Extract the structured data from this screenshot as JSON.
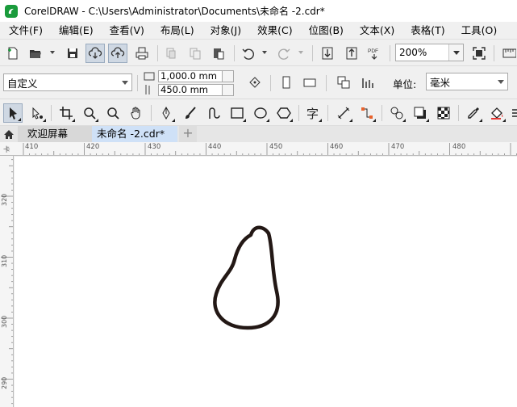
{
  "window": {
    "title": "CorelDRAW - C:\\Users\\Administrator\\Documents\\未命名 -2.cdr*"
  },
  "menu": {
    "items": [
      "文件(F)",
      "编辑(E)",
      "查看(V)",
      "布局(L)",
      "对象(J)",
      "效果(C)",
      "位图(B)",
      "文本(X)",
      "表格(T)",
      "工具(O)"
    ]
  },
  "toolbar": {
    "zoom": "200%",
    "pdf_label": "PDF"
  },
  "property_bar": {
    "preset": "自定义",
    "width": "1,000.0 mm",
    "height": "450.0 mm",
    "unit_label": "单位:",
    "unit_value": "毫米"
  },
  "toolbox": {
    "text_tool_glyph": "字"
  },
  "tabs": {
    "welcome": "欢迎屏幕",
    "document": "未命名 -2.cdr*",
    "add": "+"
  },
  "ruler": {
    "h_labels": [
      "410",
      "420",
      "430",
      "440",
      "450",
      "460",
      "470",
      "480"
    ],
    "v_labels": [
      "320",
      "310",
      "300",
      "290"
    ],
    "corner": "卡"
  },
  "colors": {
    "logo": "#1a9b3c",
    "active_tab": "#cfe1f7",
    "shape_stroke": "#231815"
  }
}
